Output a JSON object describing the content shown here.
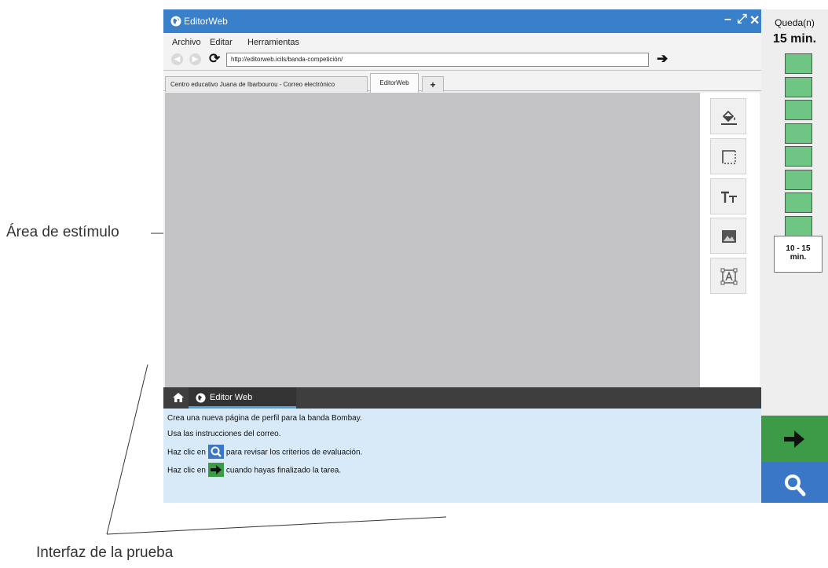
{
  "annotations": {
    "stimulus_area": "Área de estímulo",
    "test_interface": "Interfaz de la prueba"
  },
  "window": {
    "title": "EditorWeb",
    "controls": {
      "minimize": "–",
      "maximize": "⤢",
      "close": "✕"
    }
  },
  "menu": [
    "Archivo",
    "Editar",
    "Herramientas"
  ],
  "nav": {
    "url": "http://editorweb.icils/banda-competición/"
  },
  "tabs": [
    {
      "label": "Centro educativo Juana de Ibarbourou - Correo electrónico",
      "active": false
    },
    {
      "label": "EditorWeb",
      "active": true
    }
  ],
  "tab_add": "+",
  "tools": [
    "paint-bucket-icon",
    "selection-box-icon",
    "text-size-icon",
    "image-icon",
    "text-frame-icon"
  ],
  "taskbar": {
    "tab_label": "Editor Web"
  },
  "instructions": {
    "line1": "Crea una nueva página de perfil para la banda Bombay.",
    "line2": "Usa las instrucciones del correo.",
    "line3_pre": "Haz clic en",
    "line3_post": "para revisar los criterios de evaluación.",
    "line4_pre": "Haz clic en",
    "line4_post": "cuando hayas finalizado la tarea."
  },
  "timer": {
    "label": "Queda(n)",
    "value": "15 min.",
    "blocks_remaining": 8,
    "range_line1": "10 - 15",
    "range_line2": "min."
  },
  "colors": {
    "titlebar": "#3a7fc9",
    "stimulus": "#c4c4c6",
    "instructions_bg": "#d8e9f7",
    "timer_block": "#6fc684",
    "next_green": "#3d9a46",
    "review_blue": "#3a78c7"
  }
}
